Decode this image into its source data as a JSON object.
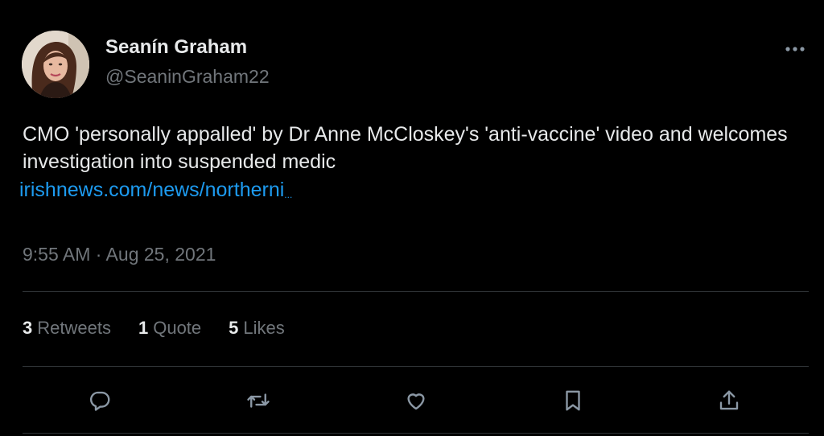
{
  "author": {
    "display_name": "Seanín Graham",
    "handle": "@SeaninGraham22"
  },
  "tweet": {
    "text": "CMO 'personally appalled' by Dr Anne McCloskey's 'anti-vaccine' video and welcomes investigation into suspended medic",
    "link_text": "irishnews.com/news/northerni",
    "link_ellipsis": "...",
    "timestamp": "9:55 AM · Aug 25, 2021"
  },
  "stats": {
    "retweets_count": "3",
    "retweets_label": "Retweets",
    "quotes_count": "1",
    "quotes_label": "Quote",
    "likes_count": "5",
    "likes_label": "Likes"
  },
  "icons": {
    "more": "more-horizontal-icon",
    "reply": "reply-icon",
    "retweet": "retweet-icon",
    "like": "heart-icon",
    "bookmark": "bookmark-icon",
    "share": "share-icon"
  },
  "colors": {
    "background": "#000000",
    "text": "#e7e9ea",
    "secondary": "#71767b",
    "link": "#1d9bf0",
    "divider": "#2f3336"
  }
}
